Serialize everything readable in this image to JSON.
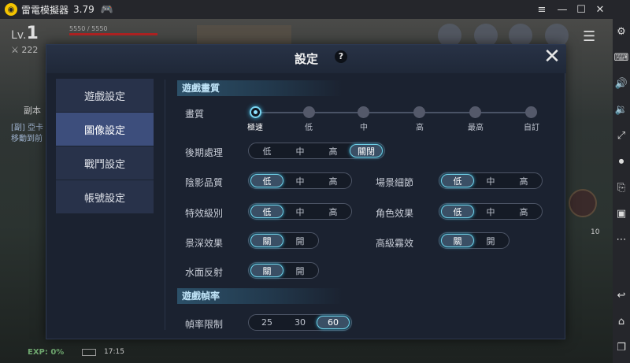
{
  "emulator": {
    "title": "雷電模擬器",
    "version": "3.79",
    "window_controls": [
      "≡",
      "—",
      "☐",
      "✕"
    ],
    "toolbar_icons": [
      "gear-icon",
      "keyboard-icon",
      "volume-up-icon",
      "volume-down-icon",
      "fullscreen-icon",
      "record-icon",
      "screenshot-icon",
      "apk-icon",
      "more-icon",
      "back-icon",
      "home-icon",
      "recent-apps-icon"
    ]
  },
  "game": {
    "level_prefix": "Lv.",
    "level": "1",
    "hp": "5550 / 5550",
    "power": "222",
    "dungeon_label": "副本",
    "quest_line1": "[副] 亞卡",
    "quest_line2": "移動到前",
    "exp": "EXP: 0%",
    "time": "17:15",
    "skill_count": "10"
  },
  "modal": {
    "title": "設定",
    "help": "?",
    "close": "✕"
  },
  "nav": [
    {
      "label": "遊戲設定",
      "active": false
    },
    {
      "label": "圖像設定",
      "active": true
    },
    {
      "label": "戰鬥設定",
      "active": false
    },
    {
      "label": "帳號設定",
      "active": false
    }
  ],
  "sections": {
    "quality_header": "遊戲畫質",
    "fps_header": "遊戲幀率"
  },
  "quality": {
    "label": "畫質",
    "options": [
      "極速",
      "低",
      "中",
      "高",
      "最高",
      "自訂"
    ],
    "selected": 0
  },
  "rows": {
    "post_processing": {
      "label": "後期處理",
      "options": [
        "低",
        "中",
        "高",
        "關閉"
      ],
      "selected": 3
    },
    "shadow": {
      "label": "陰影品質",
      "options": [
        "低",
        "中",
        "高"
      ],
      "selected": 0
    },
    "scene_detail": {
      "label": "場景細節",
      "options": [
        "低",
        "中",
        "高"
      ],
      "selected": 0
    },
    "effects": {
      "label": "特效級別",
      "options": [
        "低",
        "中",
        "高"
      ],
      "selected": 0
    },
    "character_effects": {
      "label": "角色效果",
      "options": [
        "低",
        "中",
        "高"
      ],
      "selected": 0
    },
    "depth_of_field": {
      "label": "景深效果",
      "options": [
        "關",
        "開"
      ],
      "selected": 0
    },
    "advanced_fog": {
      "label": "高級霧效",
      "options": [
        "關",
        "開"
      ],
      "selected": 0
    },
    "water_reflection": {
      "label": "水面反射",
      "options": [
        "關",
        "開"
      ],
      "selected": 0
    },
    "frame_limit": {
      "label": "幀率限制",
      "options": [
        "25",
        "30",
        "60"
      ],
      "selected": 2
    }
  },
  "colors": {
    "accent": "#6fcfe6",
    "panel": "#1b2230",
    "nav_active": "#3d4e7c"
  }
}
